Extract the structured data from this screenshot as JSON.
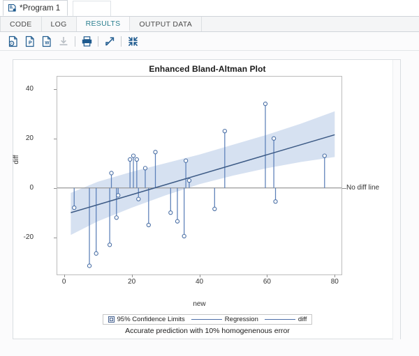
{
  "window": {
    "program_tab": {
      "label": "*Program 1",
      "icon": "program-document-icon"
    }
  },
  "view_tabs": [
    {
      "id": "code",
      "label": "CODE",
      "active": false
    },
    {
      "id": "log",
      "label": "LOG",
      "active": false
    },
    {
      "id": "results",
      "label": "RESULTS",
      "active": true
    },
    {
      "id": "output-data",
      "label": "OUTPUT DATA",
      "active": false
    }
  ],
  "toolbar": {
    "buttons": [
      {
        "id": "export-pdf",
        "icon": "export-pdf-icon",
        "title": "Download results as PDF",
        "enabled": true
      },
      {
        "id": "export-powerpoint",
        "icon": "export-powerpoint-icon",
        "title": "Download results as PowerPoint",
        "enabled": true
      },
      {
        "id": "export-word",
        "icon": "export-word-icon",
        "title": "Download results as Word",
        "enabled": true
      },
      {
        "id": "download",
        "icon": "download-icon",
        "title": "Download",
        "enabled": false
      },
      {
        "id": "print",
        "icon": "print-icon",
        "title": "Print",
        "enabled": true
      },
      {
        "id": "open-new-window",
        "icon": "open-in-new-window-icon",
        "title": "Open in new window",
        "enabled": true
      },
      {
        "id": "maximize",
        "icon": "maximize-view-icon",
        "title": "Maximize view",
        "enabled": true
      }
    ]
  },
  "colors": {
    "accent_tab": "#2a7f8f",
    "marker": "#4a6fa5",
    "stem": "#5b7fb8",
    "regression": "#3c5a85",
    "band": "#d4dff0",
    "reference_line": "#9a9a9a",
    "frame": "#bcbcbc",
    "icon": "#1e5a8e"
  },
  "chart_data": {
    "type": "scatter",
    "title": "Enhanced Bland-Altman Plot",
    "xlabel": "new",
    "ylabel": "diff",
    "xlim": [
      -2,
      82
    ],
    "ylim": [
      -35,
      45
    ],
    "xticks": [
      0,
      20,
      40,
      60,
      80
    ],
    "yticks": [
      -20,
      0,
      20,
      40
    ],
    "grid": false,
    "legend_position": "bottom-inside-box",
    "footnote": "Accurate prediction with 10% homogenenous error",
    "reference_line": {
      "y": 0,
      "label": "No diff line"
    },
    "legend": [
      {
        "id": "ci",
        "label": "95% Confidence Limits",
        "marker": "band-box"
      },
      {
        "id": "regression",
        "label": "Regression",
        "marker": "line"
      },
      {
        "id": "diff",
        "label": "diff",
        "marker": "line"
      }
    ],
    "series": [
      {
        "name": "diff",
        "type": "needle",
        "baseline": 0,
        "points": [
          {
            "x": 3.0,
            "y": -8.0
          },
          {
            "x": 7.5,
            "y": -31.5
          },
          {
            "x": 9.5,
            "y": -26.5
          },
          {
            "x": 13.5,
            "y": -23.0
          },
          {
            "x": 14.0,
            "y": 6.0
          },
          {
            "x": 15.5,
            "y": -12.0
          },
          {
            "x": 16.0,
            "y": -3.0
          },
          {
            "x": 19.5,
            "y": 11.5
          },
          {
            "x": 20.5,
            "y": 13.0
          },
          {
            "x": 21.5,
            "y": 11.5
          },
          {
            "x": 22.0,
            "y": -4.5
          },
          {
            "x": 24.0,
            "y": 8.0
          },
          {
            "x": 25.0,
            "y": -15.0
          },
          {
            "x": 27.0,
            "y": 14.5
          },
          {
            "x": 31.5,
            "y": -10.0
          },
          {
            "x": 33.5,
            "y": -13.5
          },
          {
            "x": 35.5,
            "y": -19.5
          },
          {
            "x": 36.0,
            "y": 11.0
          },
          {
            "x": 37.0,
            "y": 3.0
          },
          {
            "x": 44.5,
            "y": -8.5
          },
          {
            "x": 47.5,
            "y": 23.0
          },
          {
            "x": 59.5,
            "y": 34.0
          },
          {
            "x": 62.0,
            "y": 20.0
          },
          {
            "x": 62.5,
            "y": -5.5
          },
          {
            "x": 77.0,
            "y": 13.0
          }
        ]
      }
    ],
    "regression": {
      "x": [
        2,
        80
      ],
      "y": [
        -10.0,
        21.5
      ]
    },
    "confidence_band": {
      "level": 95,
      "x": [
        2,
        10,
        20,
        30,
        40,
        50,
        60,
        70,
        80
      ],
      "upper": [
        -2.0,
        2.5,
        6.5,
        10.0,
        13.5,
        17.5,
        21.5,
        26.0,
        31.0
      ],
      "lower": [
        -19.0,
        -13.5,
        -8.0,
        -3.0,
        1.5,
        5.0,
        8.0,
        10.5,
        12.5
      ]
    }
  }
}
